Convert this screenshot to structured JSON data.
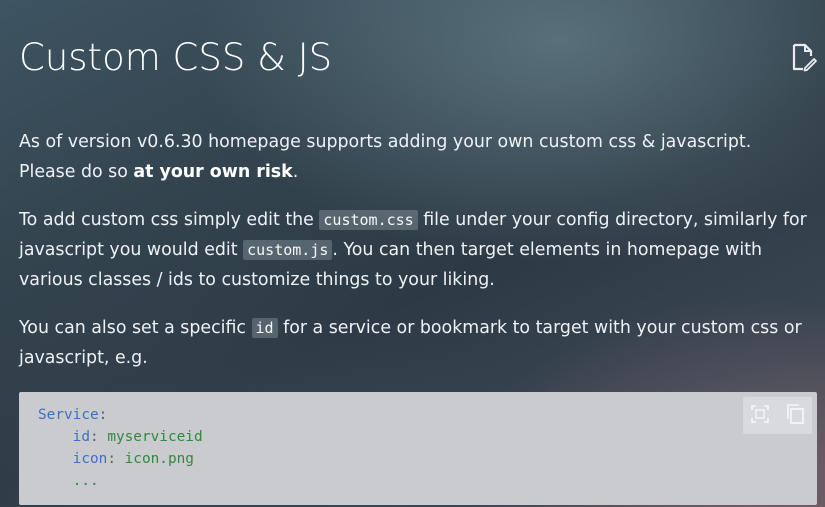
{
  "page": {
    "title": "Custom CSS & JS",
    "edit_icon": "edit-page-icon"
  },
  "content": {
    "p1": {
      "text_before": "As of version v0.6.30 homepage supports adding your own custom css & javascript. Please do so ",
      "bold": "at your own risk",
      "text_after": "."
    },
    "p2": {
      "t1": "To add custom css simply edit the ",
      "code1": "custom.css",
      "t2": " file under your config directory, similarly for javascript you would edit ",
      "code2": "custom.js",
      "t3": ". You can then target elements in homepage with various classes / ids to customize things to your liking."
    },
    "p3": {
      "t1": "You can also set a specific ",
      "code1": "id",
      "t2": " for a service or bookmark to target with your custom css or javascript, e.g."
    }
  },
  "code_block": {
    "lines": [
      {
        "key": "Service",
        "sep": ":",
        "value": ""
      },
      {
        "key": "id",
        "sep": ": ",
        "value": "myserviceid"
      },
      {
        "key": "icon",
        "sep": ": ",
        "value": "icon.png"
      },
      {
        "key": "",
        "sep": "",
        "value": "..."
      }
    ],
    "tools": {
      "select_icon": "select-all-icon",
      "copy_icon": "copy-icon"
    }
  }
}
